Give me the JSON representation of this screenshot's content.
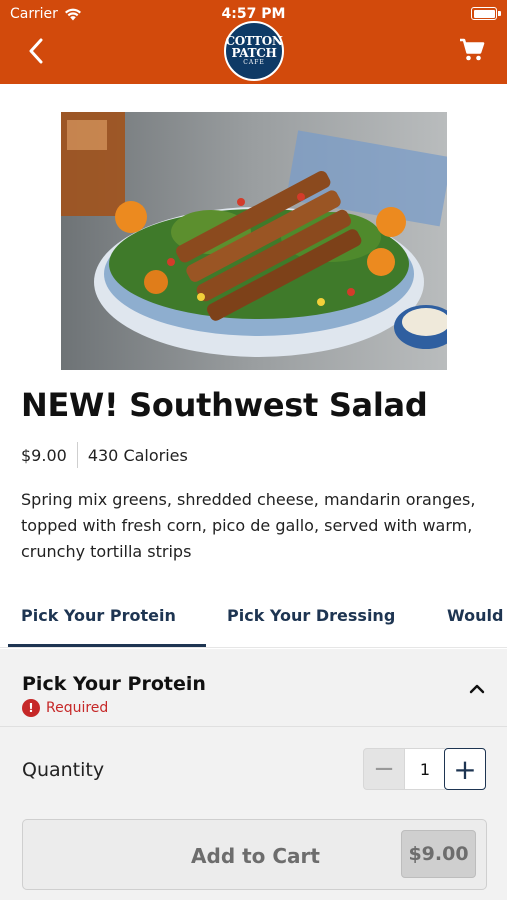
{
  "status_bar": {
    "carrier": "Carrier",
    "time": "4:57 PM"
  },
  "header": {
    "logo": {
      "line1": "COTTON",
      "line2": "PATCH",
      "line3": "CAFE"
    },
    "back_icon": "chevron-left-icon",
    "cart_icon": "shopping-cart-icon",
    "brand_color": "#D24A0C"
  },
  "product": {
    "title": "NEW! Southwest Salad",
    "price": "$9.00",
    "calories": "430 Calories",
    "description": "Spring mix greens, shredded cheese, mandarin oranges, topped with fresh corn, pico de gallo, served with warm, crunchy tortilla strips"
  },
  "tabs": [
    {
      "label": "Pick Your Protein",
      "active": true
    },
    {
      "label": "Pick Your Dressing",
      "active": false
    },
    {
      "label": "Would",
      "active": false
    }
  ],
  "section": {
    "title": "Pick Your Protein",
    "required_label": "Required",
    "expanded": true
  },
  "quantity": {
    "label": "Quantity",
    "value": "1",
    "minus_symbol": "−",
    "plus_symbol": "+"
  },
  "add_to_cart": {
    "label": "Add to Cart",
    "price": "$9.00"
  },
  "colors": {
    "accent_navy": "#1e3552",
    "required_red": "#c62828"
  }
}
